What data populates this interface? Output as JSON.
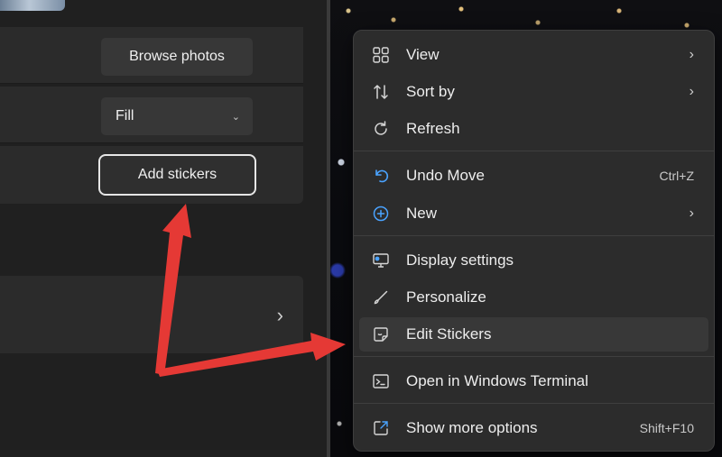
{
  "settings": {
    "browse_button": "Browse photos",
    "fit_select": {
      "value": "Fill"
    },
    "stickers_button": "Add stickers"
  },
  "context_menu": {
    "items": [
      {
        "label": "View",
        "icon": "grid-view-icon",
        "has_submenu": true
      },
      {
        "label": "Sort by",
        "icon": "sort-arrows-icon",
        "has_submenu": true
      },
      {
        "label": "Refresh",
        "icon": "refresh-icon",
        "has_submenu": false
      },
      {
        "label": "Undo Move",
        "icon": "undo-icon",
        "shortcut": "Ctrl+Z"
      },
      {
        "label": "New",
        "icon": "new-plus-icon",
        "has_submenu": true
      },
      {
        "label": "Display settings",
        "icon": "display-icon"
      },
      {
        "label": "Personalize",
        "icon": "brush-icon"
      },
      {
        "label": "Edit Stickers",
        "icon": "sticker-icon",
        "highlighted": true
      },
      {
        "label": "Open in Windows Terminal",
        "icon": "terminal-icon"
      },
      {
        "label": "Show more options",
        "icon": "share-icon",
        "shortcut": "Shift+F10"
      }
    ]
  },
  "colors": {
    "annotation_arrow": "#e53935",
    "accent_blue": "#4aa3ff"
  }
}
